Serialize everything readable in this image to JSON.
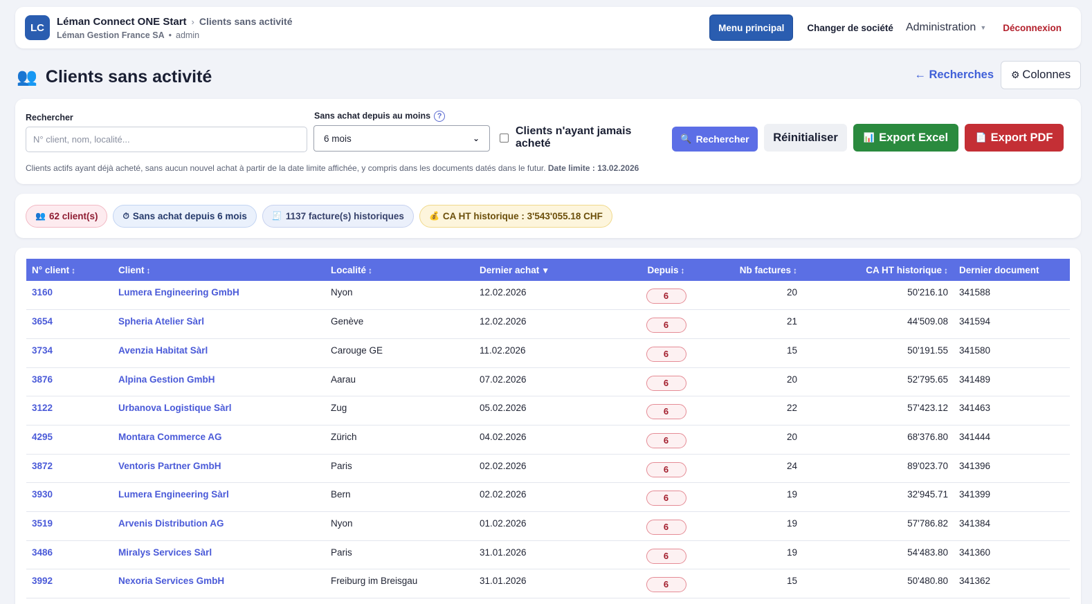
{
  "header": {
    "logo": "LC",
    "app_name": "Léman Connect ONE Start",
    "breadcrumb_sep": "›",
    "breadcrumb_page": "Clients sans activité",
    "company": "Léman Gestion France SA",
    "user": "admin",
    "menu_button": "Menu principal",
    "switch_company": "Changer de société",
    "admin": "Administration",
    "logout": "Déconnexion"
  },
  "page": {
    "title": "Clients sans activité",
    "back_link": "← Recherches",
    "columns_button": "Colonnes"
  },
  "filters": {
    "search_label": "Rechercher",
    "search_placeholder": "N° client, nom, localité...",
    "search_value": "",
    "period_label": "Sans achat depuis au moins",
    "period_value": "6 mois",
    "never_bought_label": "Clients n'ayant jamais acheté",
    "never_bought_checked": false,
    "search_button": "Rechercher",
    "reset_button": "Réinitialiser",
    "excel_button": "Export Excel",
    "pdf_button": "Export PDF",
    "note": "Clients actifs ayant déjà acheté, sans aucun nouvel achat à partir de la date limite affichée, y compris dans les documents datés dans le futur.",
    "note_date": "Date limite : 13.02.2026"
  },
  "stats": {
    "clients": "62 client(s)",
    "since": "Sans achat depuis 6 mois",
    "invoices": "1137 facture(s) historiques",
    "ca": "CA HT historique : 3'543'055.18 CHF"
  },
  "table": {
    "headers": {
      "client_no": "N° client",
      "client": "Client",
      "locality": "Localité",
      "last_purchase": "Dernier achat",
      "since": "Depuis",
      "invoices": "Nb factures",
      "ca": "CA HT historique",
      "last_doc": "Dernier document"
    },
    "rows": [
      {
        "no": "3160",
        "client": "Lumera Engineering GmbH",
        "locality": "Nyon",
        "last": "12.02.2026",
        "since": "6",
        "invoices": "20",
        "ca": "50'216.10",
        "doc": "341588"
      },
      {
        "no": "3654",
        "client": "Spheria Atelier Sàrl",
        "locality": "Genève",
        "last": "12.02.2026",
        "since": "6",
        "invoices": "21",
        "ca": "44'509.08",
        "doc": "341594"
      },
      {
        "no": "3734",
        "client": "Avenzia Habitat Sàrl",
        "locality": "Carouge GE",
        "last": "11.02.2026",
        "since": "6",
        "invoices": "15",
        "ca": "50'191.55",
        "doc": "341580"
      },
      {
        "no": "3876",
        "client": "Alpina Gestion GmbH",
        "locality": "Aarau",
        "last": "07.02.2026",
        "since": "6",
        "invoices": "20",
        "ca": "52'795.65",
        "doc": "341489"
      },
      {
        "no": "3122",
        "client": "Urbanova Logistique Sàrl",
        "locality": "Zug",
        "last": "05.02.2026",
        "since": "6",
        "invoices": "22",
        "ca": "57'423.12",
        "doc": "341463"
      },
      {
        "no": "4295",
        "client": "Montara Commerce AG",
        "locality": "Zürich",
        "last": "04.02.2026",
        "since": "6",
        "invoices": "20",
        "ca": "68'376.80",
        "doc": "341444"
      },
      {
        "no": "3872",
        "client": "Ventoris Partner GmbH",
        "locality": "Paris",
        "last": "02.02.2026",
        "since": "6",
        "invoices": "24",
        "ca": "89'023.70",
        "doc": "341396"
      },
      {
        "no": "3930",
        "client": "Lumera Engineering Sàrl",
        "locality": "Bern",
        "last": "02.02.2026",
        "since": "6",
        "invoices": "19",
        "ca": "32'945.71",
        "doc": "341399"
      },
      {
        "no": "3519",
        "client": "Arvenis Distribution AG",
        "locality": "Nyon",
        "last": "01.02.2026",
        "since": "6",
        "invoices": "19",
        "ca": "57'786.82",
        "doc": "341384"
      },
      {
        "no": "3486",
        "client": "Miralys Services Sàrl",
        "locality": "Paris",
        "last": "31.01.2026",
        "since": "6",
        "invoices": "19",
        "ca": "54'483.80",
        "doc": "341360"
      },
      {
        "no": "3992",
        "client": "Nexoria Services GmbH",
        "locality": "Freiburg im Breisgau",
        "last": "31.01.2026",
        "since": "6",
        "invoices": "15",
        "ca": "50'480.80",
        "doc": "341362"
      }
    ]
  }
}
